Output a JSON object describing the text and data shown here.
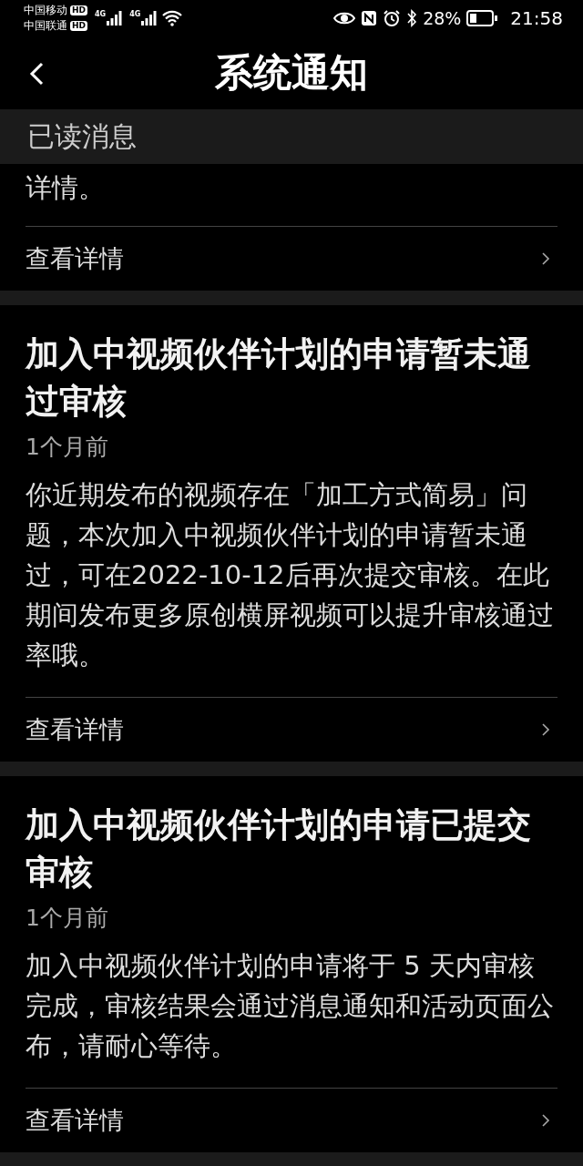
{
  "status_bar": {
    "carriers": [
      {
        "name": "中国移动",
        "badge": "HD"
      },
      {
        "name": "中国联通",
        "badge": "HD"
      }
    ],
    "networks": [
      "4G",
      "4G"
    ],
    "battery_text": "28%",
    "time": "21:58"
  },
  "header": {
    "title": "系统通知"
  },
  "section_label": "已读消息",
  "notices": [
    {
      "kind": "partial",
      "body": "详情。",
      "link": "查看详情"
    },
    {
      "kind": "full",
      "title": "加入中视频伙伴计划的申请暂未通过审核",
      "time": "1个月前",
      "body": "你近期发布的视频存在「加工方式简易」问题，本次加入中视频伙伴计划的申请暂未通过，可在2022-10-12后再次提交审核。在此期间发布更多原创横屏视频可以提升审核通过率哦。",
      "link": "查看详情"
    },
    {
      "kind": "full",
      "title": "加入中视频伙伴计划的申请已提交审核",
      "time": "1个月前",
      "body": "加入中视频伙伴计划的申请将于 5 天内审核完成，审核结果会通过消息通知和活动页面公布，请耐心等待。",
      "link": "查看详情"
    }
  ]
}
